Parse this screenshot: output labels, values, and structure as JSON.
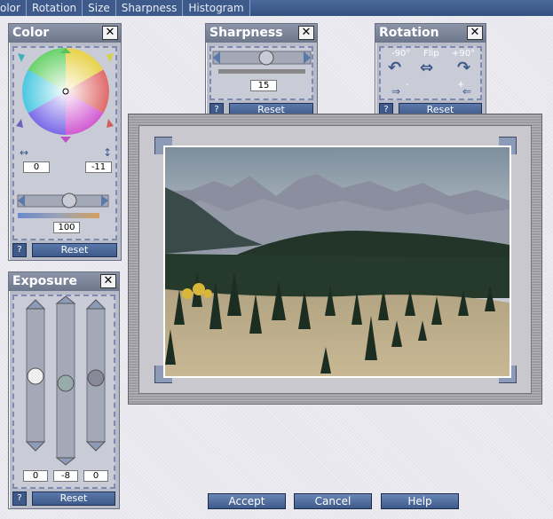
{
  "menu": [
    "olor",
    "Rotation",
    "Size",
    "Sharpness",
    "Histogram"
  ],
  "color_panel": {
    "title": "Color",
    "close": "✕",
    "h_value": "0",
    "v_value": "-11",
    "slider_value": "100",
    "help": "?",
    "reset": "Reset"
  },
  "sharpness_panel": {
    "title": "Sharpness",
    "close": "✕",
    "value": "15",
    "help": "?",
    "reset": "Reset"
  },
  "rotation_panel": {
    "title": "Rotation",
    "close": "✕",
    "left_label": "-90°",
    "flip_label": "Flip",
    "right_label": "+90°",
    "minus": "-",
    "plus": "+",
    "help": "?",
    "reset": "Reset"
  },
  "exposure_panel": {
    "title": "Exposure",
    "close": "✕",
    "values": [
      "0",
      "-8",
      "0"
    ],
    "help": "?",
    "reset": "Reset"
  },
  "buttons": {
    "accept": "Accept",
    "cancel": "Cancel",
    "help": "Help"
  }
}
